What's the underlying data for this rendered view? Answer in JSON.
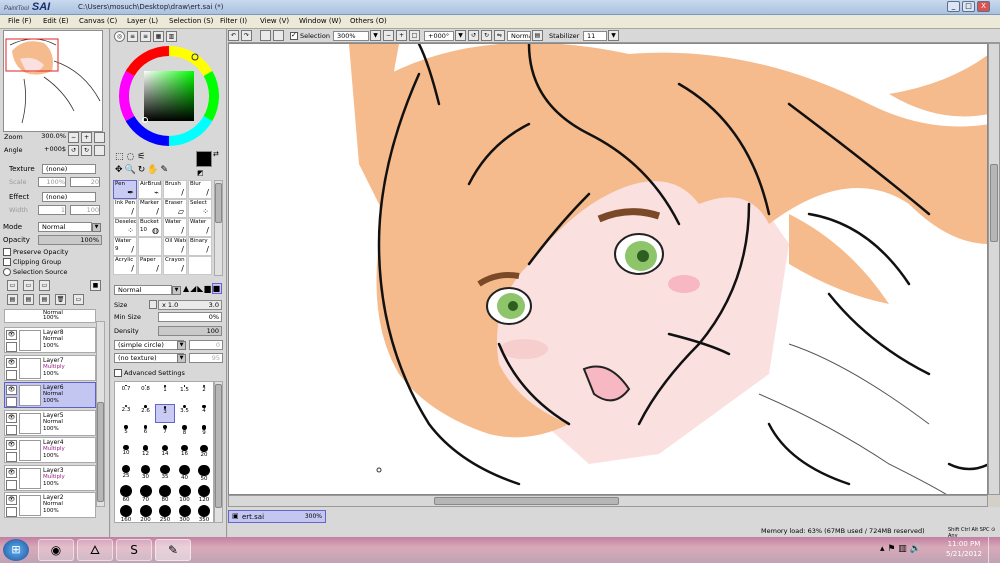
{
  "window": {
    "app_name": "SAI",
    "app_vendor": "PaintTool",
    "title": "C:\\Users\\mosuch\\Desktop\\draw\\ert.sai (*)",
    "controls": [
      "_",
      "□",
      "X"
    ]
  },
  "menubar": [
    "File (F)",
    "Edit (E)",
    "Canvas (C)",
    "Layer (L)",
    "Selection (S)",
    "Filter (I)",
    "View (V)",
    "Window (W)",
    "Others (O)"
  ],
  "navigator": {
    "zoom_label": "Zoom",
    "zoom_value": "300.0%",
    "angle_label": "Angle",
    "angle_value": "+000$",
    "btn_minus": "−",
    "btn_plus": "+",
    "btn_rotl": "↺",
    "btn_rotr": "↻"
  },
  "layer_props": {
    "texture_label": "Texture",
    "texture_value": "(none)",
    "scale_label": "Scale",
    "scale_value": "100%",
    "effect_label": "Effect",
    "effect_value": "(none)",
    "width_label": "Width",
    "width_value": "1",
    "mode_label": "Mode",
    "mode_value": "Normal",
    "opacity_label": "Opacity",
    "opacity_value": "100%",
    "preserve_opacity": "Preserve Opacity",
    "clipping_group": "Clipping Group",
    "selection_source": "Selection Source"
  },
  "layers": [
    {
      "name": "Layer8",
      "mode": "Normal",
      "opacity": "100%",
      "selected": false
    },
    {
      "name": "Layer7",
      "mode": "Multiply",
      "opacity": "100%",
      "selected": false
    },
    {
      "name": "Layer6",
      "mode": "Normal",
      "opacity": "100%",
      "selected": true
    },
    {
      "name": "Layer5",
      "mode": "Normal",
      "opacity": "100%",
      "selected": false
    },
    {
      "name": "Layer4",
      "mode": "Multiply",
      "opacity": "100%",
      "selected": false
    },
    {
      "name": "Layer3",
      "mode": "Multiply",
      "opacity": "100%",
      "selected": false
    },
    {
      "name": "Layer2",
      "mode": "Normal",
      "opacity": "100%",
      "selected": false
    }
  ],
  "layer_top_partial": {
    "mode": "Normal",
    "opacity": "100%"
  },
  "tools": [
    {
      "label": "Pen",
      "icon": "✒"
    },
    {
      "label": "AirBrush",
      "icon": "⌁"
    },
    {
      "label": "Brush",
      "icon": "/"
    },
    {
      "label": "Blur",
      "icon": "/"
    },
    {
      "label": "Ink Pen",
      "icon": "/"
    },
    {
      "label": "Marker",
      "icon": "/"
    },
    {
      "label": "Eraser",
      "icon": "▱"
    },
    {
      "label": "Select",
      "icon": "⁘"
    },
    {
      "label": "Deselect",
      "icon": "⁘"
    },
    {
      "label": "Bucket",
      "icon": "◍"
    },
    {
      "label": "Water",
      "icon": "/"
    },
    {
      "label": "Water",
      "icon": "/"
    },
    {
      "label": "Water",
      "icon": "/"
    },
    {
      "label": "",
      "icon": ""
    },
    {
      "label": "Oil Wate",
      "icon": "/"
    },
    {
      "label": "Binary",
      "icon": "/"
    },
    {
      "label": "Acrylic",
      "icon": "/"
    },
    {
      "label": "Paper",
      "icon": "/"
    },
    {
      "label": "Crayon",
      "icon": "/"
    },
    {
      "label": "",
      "icon": ""
    }
  ],
  "tool_numbers": {
    "bucket": "10",
    "water_left": "9"
  },
  "brush": {
    "blend_mode": "Normal",
    "size_label": "Size",
    "size_mult": "x 1.0",
    "size_value": "3.0",
    "minsize_label": "Min Size",
    "minsize_value": "0%",
    "density_label": "Density",
    "density_value": "100",
    "shape_value": "(simple circle)",
    "shape_num": "0",
    "texture_value": "(no texture)",
    "texture_num": "95",
    "advanced_label": "Advanced Settings"
  },
  "brush_sizes": [
    "0.7",
    "0.8",
    "1",
    "1.5",
    "2",
    "2.3",
    "2.6",
    "3",
    "3.5",
    "4",
    "5",
    "6",
    "7",
    "8",
    "9",
    "10",
    "12",
    "14",
    "16",
    "20",
    "25",
    "30",
    "35",
    "40",
    "50",
    "60",
    "70",
    "80",
    "100",
    "120",
    "160",
    "200",
    "250",
    "300",
    "350"
  ],
  "canvas_toolbar": {
    "selection_label": "Selection",
    "zoom_value": "300%",
    "angle_value": "+000°",
    "blend_value": "Normal",
    "stabilizer_label": "Stabilizer",
    "stabilizer_value": "11"
  },
  "doc_tab": {
    "name": "ert.sai",
    "zoom": "300%"
  },
  "status": {
    "memory": "Memory load: 63% (67MB used / 724MB reserved)",
    "keys": "Shift Ctrl Alt SPC ⊙ Any"
  },
  "taskbar": {
    "time": "11:00 PM",
    "date": "5/21/2012"
  },
  "colors": {
    "skin": "#fbe0e0",
    "hair": "#f6bb8c",
    "eye": "#8ec46a",
    "selection": "#c4c6f2"
  }
}
